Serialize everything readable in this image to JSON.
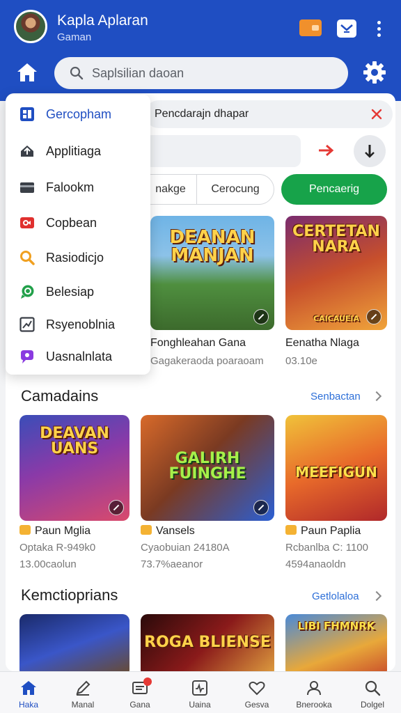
{
  "header": {
    "app_title": "Kapla Aplaran",
    "app_subtitle": "Gaman",
    "search_placeholder": "Saplsilian daoan"
  },
  "panel": {
    "search_chip": "Pencdarajn dhapar",
    "tabs": [
      "nakge",
      "Cerocung",
      "Pencaerig"
    ]
  },
  "menu": {
    "items": [
      {
        "label": "Gercopham",
        "icon": "dashboard-icon"
      },
      {
        "label": "Applitiaga",
        "icon": "upload-icon"
      },
      {
        "label": "Falookm",
        "icon": "card-icon"
      },
      {
        "label": "Copbean",
        "icon": "video-icon"
      },
      {
        "label": "Rasiodicjo",
        "icon": "search-icon"
      },
      {
        "label": "Belesiap",
        "icon": "chat-icon"
      },
      {
        "label": "Rsyenoblnia",
        "icon": "chart-icon"
      },
      {
        "label": "Uasnalnlata",
        "icon": "message-icon"
      }
    ]
  },
  "featured": [
    {
      "art_text": "DEANAN MANJAN",
      "title": "Fonghleahan Gana",
      "subtitle": "Gagakeraoda poaraoam"
    },
    {
      "art_text": "CERTETAN NARA",
      "art_caption": "CAICAUEIA",
      "title": "Eenatha Nlaga",
      "subtitle": "03.10e"
    }
  ],
  "sections": [
    {
      "title": "Camadains",
      "see_all": "Senbactan",
      "items": [
        {
          "art_text": "DEAVAN UANS",
          "title": "Paun Mglia",
          "line1": "Optaka R-949k0",
          "line2": "13.00caolun"
        },
        {
          "art_text": "GALIRH FUINGHE",
          "title": "Vansels",
          "line1": "Cyaobuian 24180A",
          "line2": "73.7%aeanor"
        },
        {
          "art_text": "MEEFIGUN",
          "title": "Paun Paplia",
          "line1": "Rcbanlba C: 1100",
          "line2": "4594anaoldn"
        }
      ]
    },
    {
      "title": "Kemctioprians",
      "see_all": "Getlolaloa",
      "items": [
        {
          "art_text": ""
        },
        {
          "art_text": "ROGA BLIENSE"
        },
        {
          "art_text": "LIBI FHMNRK"
        }
      ]
    }
  ],
  "bottom_nav": [
    {
      "label": "Haka",
      "icon": "home-icon"
    },
    {
      "label": "Manal",
      "icon": "pen-icon"
    },
    {
      "label": "Gana",
      "icon": "inbox-icon"
    },
    {
      "label": "Uaina",
      "icon": "activity-icon"
    },
    {
      "label": "Gesva",
      "icon": "heart-icon"
    },
    {
      "label": "Bnerooka",
      "icon": "profile-icon"
    },
    {
      "label": "Dolgel",
      "icon": "search-icon"
    }
  ],
  "colors": {
    "brand_blue": "#1f4ec2",
    "active_tab_green": "#17a34a",
    "link_blue": "#2d6fd8",
    "clear_red": "#e53935"
  }
}
